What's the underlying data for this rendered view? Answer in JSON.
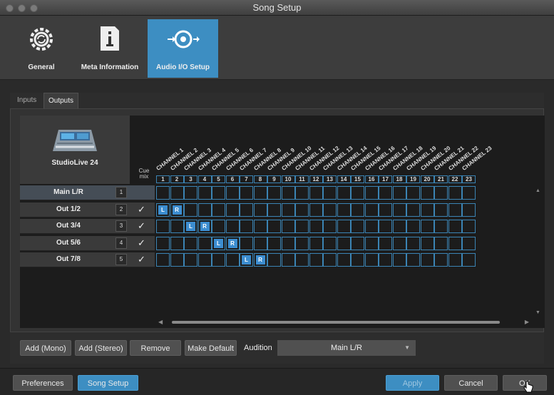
{
  "window": {
    "title": "Song Setup"
  },
  "top_tabs": [
    {
      "label": "General",
      "icon": "gear-sync-icon",
      "active": false
    },
    {
      "label": "Meta Information",
      "icon": "info-document-icon",
      "active": false
    },
    {
      "label": "Audio I/O Setup",
      "icon": "audio-io-icon",
      "active": true
    }
  ],
  "sub_tabs": [
    {
      "label": "Inputs",
      "active": false
    },
    {
      "label": "Outputs",
      "active": true
    }
  ],
  "device": {
    "name": "StudioLive 24",
    "icon": "mixer-device-icon"
  },
  "cue_mix_label": "Cue mix",
  "channels": [
    {
      "name": "CHANNEL 1",
      "num": "1"
    },
    {
      "name": "CHANNEL 2",
      "num": "2"
    },
    {
      "name": "CHANNEL 3",
      "num": "3"
    },
    {
      "name": "CHANNEL 4",
      "num": "4"
    },
    {
      "name": "CHANNEL 5",
      "num": "5"
    },
    {
      "name": "CHANNEL 6",
      "num": "6"
    },
    {
      "name": "CHANNEL 7",
      "num": "7"
    },
    {
      "name": "CHANNEL 8",
      "num": "8"
    },
    {
      "name": "CHANNEL 9",
      "num": "9"
    },
    {
      "name": "CHANNEL 10",
      "num": "10"
    },
    {
      "name": "CHANNEL 11",
      "num": "11"
    },
    {
      "name": "CHANNEL 12",
      "num": "12"
    },
    {
      "name": "CHANNEL 13",
      "num": "13"
    },
    {
      "name": "CHANNEL 14",
      "num": "14"
    },
    {
      "name": "CHANNEL 15",
      "num": "15"
    },
    {
      "name": "CHANNEL 16",
      "num": "16"
    },
    {
      "name": "CHANNEL 17",
      "num": "17"
    },
    {
      "name": "CHANNEL 18",
      "num": "18"
    },
    {
      "name": "CHANNEL 19",
      "num": "19"
    },
    {
      "name": "CHANNEL 20",
      "num": "20"
    },
    {
      "name": "CHANNEL 21",
      "num": "21"
    },
    {
      "name": "CHANNEL 22",
      "num": "22"
    },
    {
      "name": "CHANNEL 23",
      "num": "23"
    }
  ],
  "outputs": [
    {
      "label": "Main L/R",
      "num": "1",
      "cue_mix": false,
      "left_channel": null,
      "right_channel": null
    },
    {
      "label": "Out 1/2",
      "num": "2",
      "cue_mix": true,
      "left_channel": 1,
      "right_channel": 2
    },
    {
      "label": "Out 3/4",
      "num": "3",
      "cue_mix": true,
      "left_channel": 3,
      "right_channel": 4
    },
    {
      "label": "Out 5/6",
      "num": "4",
      "cue_mix": true,
      "left_channel": 5,
      "right_channel": 6
    },
    {
      "label": "Out 7/8",
      "num": "5",
      "cue_mix": true,
      "left_channel": 7,
      "right_channel": 8
    }
  ],
  "pill_labels": {
    "left": "L",
    "right": "R"
  },
  "check_glyph": "✓",
  "actions": {
    "add_mono": "Add (Mono)",
    "add_stereo": "Add (Stereo)",
    "remove": "Remove",
    "make_default": "Make Default",
    "audition_label": "Audition",
    "audition_value": "Main L/R"
  },
  "footer": {
    "preferences": "Preferences",
    "song_setup": "Song Setup",
    "apply": "Apply",
    "cancel": "Cancel",
    "ok": "OK"
  },
  "colors": {
    "accent": "#3d8ec2",
    "grid": "#3b84b4",
    "pill": "#3c8dd0"
  }
}
